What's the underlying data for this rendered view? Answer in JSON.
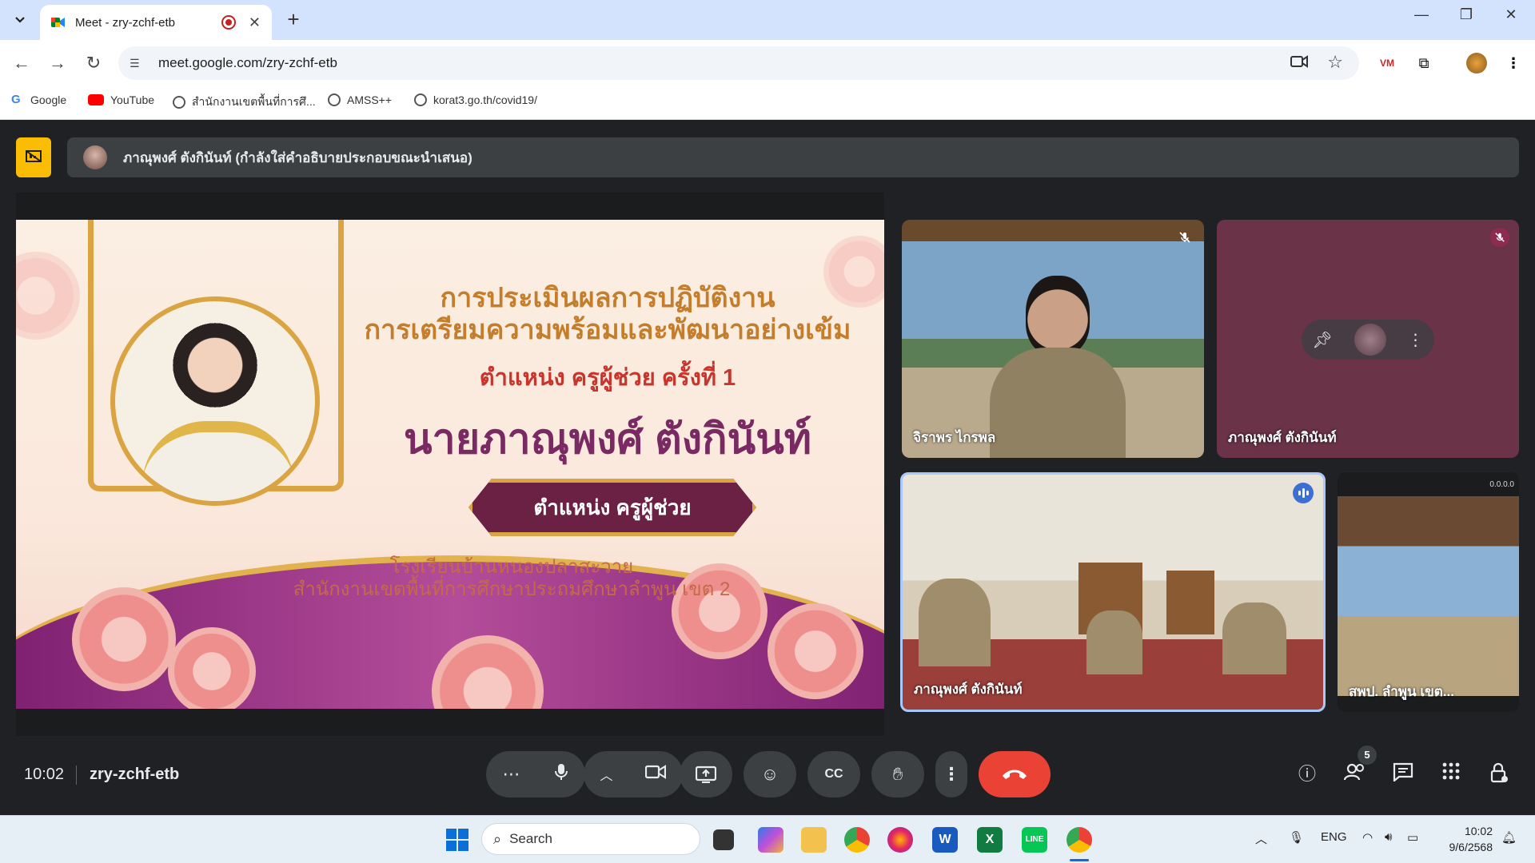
{
  "browser": {
    "tab_title": "Meet - zry-zchf-etb",
    "url": "meet.google.com/zry-zchf-etb",
    "bookmarks": [
      "Google",
      "YouTube",
      "สำนักงานเขตพื้นที่การศึ...",
      "AMSS++",
      "korat3.go.th/covid19/"
    ]
  },
  "meeting": {
    "presenter_banner": "ภาณุพงศ์ ตังกินันท์ (กำลังใส่คำอธิบายประกอบขณะนำเสนอ)",
    "slide": {
      "title_line1": "การประเมินผลการปฏิบัติงาน",
      "title_line2": "การเตรียมความพร้อมและพัฒนาอย่างเข้ม",
      "round": "ตำแหน่ง ครูผู้ช่วย ครั้งที่ 1",
      "name": "นายภาณุพงศ์  ตังกินันท์",
      "position_ribbon": "ตำแหน่ง ครูผู้ช่วย",
      "school": "โรงเรียนบ้านหนองปลาสะวาย",
      "office": "สำนักงานเขตพื้นที่การศึกษาประถมศึกษาลำพูน เขต 2"
    },
    "participants": [
      {
        "name": "จิราพร ไกรพล",
        "muted": true
      },
      {
        "name": "ภาณุพงศ์ ตังกินันท์",
        "muted": true
      },
      {
        "name": "ภาณุพงศ์ ตังกินันท์",
        "speaking": true
      },
      {
        "name": "สพป. ลำพูน เขต...",
        "corner_label": "0.0.0.0"
      }
    ],
    "time": "10:02",
    "code": "zry-zchf-etb",
    "people_count": "5"
  },
  "taskbar": {
    "search_placeholder": "Search",
    "lang": "ENG",
    "time": "10:02",
    "date": "9/6/2568"
  },
  "colors": {
    "accent": "#fbbc04",
    "end_call": "#ea4335",
    "meet_bg": "#202124",
    "speaking": "#3b6fd1"
  }
}
